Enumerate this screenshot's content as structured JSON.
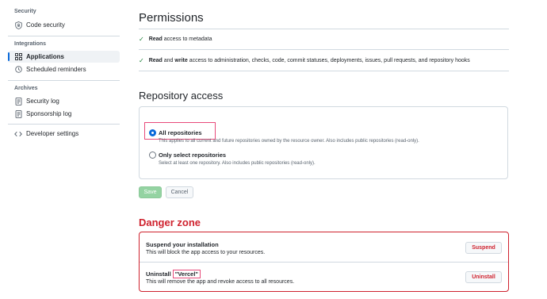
{
  "sidebar": {
    "sections": [
      {
        "title": "Security",
        "items": [
          {
            "label": "Code security",
            "icon": "shield-lock-icon"
          }
        ]
      },
      {
        "title": "Integrations",
        "items": [
          {
            "label": "Applications",
            "icon": "apps-grid-icon",
            "active": true
          },
          {
            "label": "Scheduled reminders",
            "icon": "clock-icon"
          }
        ]
      },
      {
        "title": "Archives",
        "items": [
          {
            "label": "Security log",
            "icon": "log-icon"
          },
          {
            "label": "Sponsorship log",
            "icon": "log-icon"
          }
        ]
      }
    ],
    "developer_settings": {
      "label": "Developer settings",
      "icon": "code-icon"
    }
  },
  "permissions": {
    "title": "Permissions",
    "rows": [
      {
        "bold1": "Read",
        "text1": " access to metadata"
      },
      {
        "bold1": "Read",
        "mid": " and ",
        "bold2": "write",
        "text2": " access to administration, checks, code, commit statuses, deployments, issues, pull requests, and repository hooks"
      }
    ]
  },
  "repository_access": {
    "title": "Repository access",
    "options": [
      {
        "label": "All repositories",
        "description": "This applies to all current and future repositories owned by the resource owner. Also includes public repositories (read-only).",
        "selected": true
      },
      {
        "label": "Only select repositories",
        "description": "Select at least one repository. Also includes public repositories (read-only).",
        "selected": false
      }
    ],
    "save_label": "Save",
    "cancel_label": "Cancel"
  },
  "danger_zone": {
    "title": "Danger zone",
    "suspend": {
      "title": "Suspend your installation",
      "description": "This will block the app access to your resources.",
      "button": "Suspend"
    },
    "uninstall": {
      "title_prefix": "Uninstall ",
      "app_name": "\"Vercel\"",
      "description": "This will remove the app and revoke access to all resources.",
      "button": "Uninstall"
    }
  },
  "colors": {
    "accent": "#0969da",
    "success": "#1a7f37",
    "danger": "#cf222e",
    "highlight": "#e84a7a"
  }
}
